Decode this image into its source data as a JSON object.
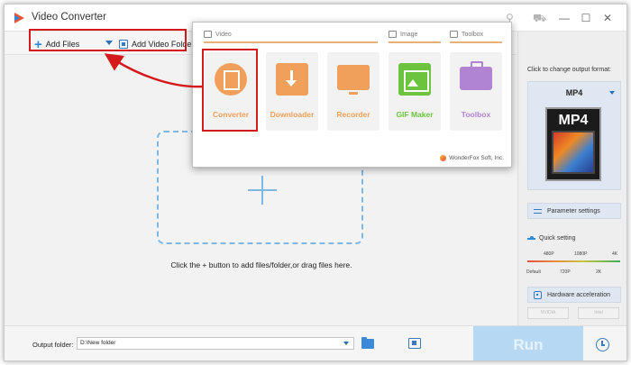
{
  "window": {
    "title": "Video Converter",
    "minimize": "—",
    "maximize": "☐",
    "close": "✕"
  },
  "toolbar": {
    "add_files": "Add Files",
    "add_video_folder": "Add Video Folder"
  },
  "main": {
    "drop_hint": "Click the + button to add files/folder,or drag files here."
  },
  "launcher": {
    "sections": {
      "video": "Video",
      "image": "Image",
      "toolbox": "Toolbox"
    },
    "tiles": [
      {
        "label": "Converter",
        "color": "#f0a05a"
      },
      {
        "label": "Downloader",
        "color": "#f0a05a"
      },
      {
        "label": "Recorder",
        "color": "#f0a05a"
      },
      {
        "label": "GIF Maker",
        "color": "#6cc33d"
      },
      {
        "label": "Toolbox",
        "color": "#b183d3"
      }
    ],
    "brand": "WonderFox Soft, Inc."
  },
  "right_panel": {
    "title": "Click to change output format:",
    "format": "MP4",
    "format_icon_text": "MP4",
    "parameter_settings": "Parameter settings",
    "quick_setting": "Quick setting",
    "quality_top": [
      "480P",
      "1080P",
      "4K"
    ],
    "quality_bottom": [
      "Default",
      "720P",
      "2K"
    ],
    "hardware_acceleration": "Hardware acceleration",
    "gpu": [
      "NVIDIA",
      "Intel"
    ]
  },
  "bottom": {
    "output_label": "Output folder:",
    "output_value": "D:\\New folder",
    "run": "Run"
  },
  "colors": {
    "accent": "#2c8ad6",
    "highlight": "#d41a1a",
    "run_disabled": "#b7d8f3"
  }
}
